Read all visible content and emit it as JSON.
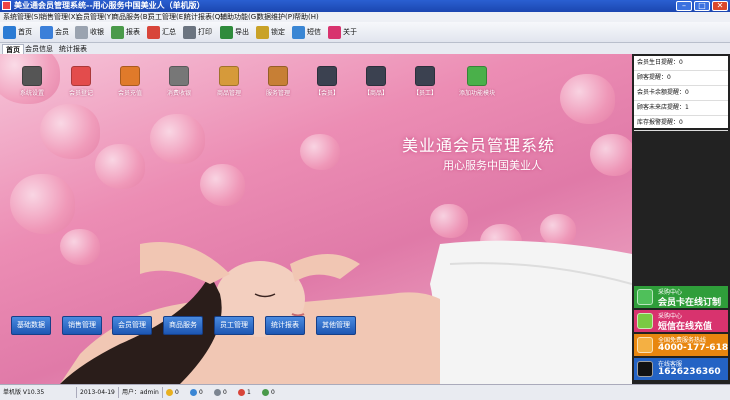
{
  "window": {
    "title": "美业通会员管理系统--用心服务中国美业人（单机版）",
    "minimize": "–",
    "maximize": "□",
    "close": "✕"
  },
  "menu": [
    "系统管理(S)",
    "销售管理(X)",
    "会员管理(Y)",
    "商品服务(B)",
    "员工管理(E)",
    "统计报表(Q)",
    "辅助功能(G)",
    "数据维护(P)",
    "帮助(H)"
  ],
  "toolbar": [
    {
      "label": "首页",
      "icon": "monitor-icon",
      "color": "#2b7bd4"
    },
    {
      "label": "会员",
      "icon": "member-card-icon",
      "color": "#3b7fd9"
    },
    {
      "label": "收银",
      "icon": "calculator-icon",
      "color": "#9aa3b0"
    },
    {
      "label": "报表",
      "icon": "spreadsheet-icon",
      "color": "#4a9a4a"
    },
    {
      "label": "汇总",
      "icon": "bar-chart-icon",
      "color": "#d8453a"
    },
    {
      "label": "打印",
      "icon": "printer-icon",
      "color": "#6b7480"
    },
    {
      "label": "导出",
      "icon": "excel-icon",
      "color": "#2f8b3c"
    },
    {
      "label": "锁定",
      "icon": "lock-icon",
      "color": "#c9a227"
    },
    {
      "label": "短信",
      "icon": "sms-icon",
      "color": "#3a86d4"
    },
    {
      "label": "关于",
      "icon": "about-icon",
      "color": "#d8336e"
    }
  ],
  "tabs": [
    "首页",
    "会员信息",
    "统计报表"
  ],
  "desktop_icons": [
    {
      "label": "系统设置",
      "icon": "settings-icon",
      "color": "#555"
    },
    {
      "label": "会员登记",
      "icon": "register-icon",
      "color": "#e34c4c"
    },
    {
      "label": "会员充值",
      "icon": "recharge-icon",
      "color": "#e07a2a"
    },
    {
      "label": "消费收银",
      "icon": "cashier-icon",
      "color": "#777"
    },
    {
      "label": "商品管理",
      "icon": "goods-icon",
      "color": "#d69a3a"
    },
    {
      "label": "服务管理",
      "icon": "service-icon",
      "color": "#c77f35"
    },
    {
      "label": "【会员】",
      "icon": "member-report-icon",
      "color": "#3b4150"
    },
    {
      "label": "【商品】",
      "icon": "goods-report-icon",
      "color": "#3b4150"
    },
    {
      "label": "【员工】",
      "icon": "staff-report-icon",
      "color": "#3b4150"
    },
    {
      "label": "添加功能模块",
      "icon": "add-module-icon",
      "color": "#4ab04a"
    }
  ],
  "banner": {
    "title": "美业通会员管理系统",
    "subtitle": "用心服务中国美业人"
  },
  "module_buttons": [
    "基础数据",
    "销售管理",
    "会员管理",
    "商品服务",
    "员工管理",
    "统计报表",
    "其他管理"
  ],
  "reminders": [
    "会员生日提醒：0",
    "顾客提醒：0",
    "会员卡余额提醒：0",
    "顾客未来店提醒：1",
    "库存报警提醒：0"
  ],
  "ads": [
    {
      "small": "采购中心",
      "big": "会员卡在线订制",
      "color": "#2f9e3a",
      "icon": "card-order-icon"
    },
    {
      "small": "采购中心",
      "big": "短信在线充值",
      "color": "#d8336e",
      "icon": "sms-recharge-icon"
    },
    {
      "small": "全国免费服务热线",
      "big": "4000-177-618",
      "color": "#e8860f",
      "icon": "hotline-icon"
    },
    {
      "small": "在线客服",
      "big": "1626236360",
      "color": "#2463c4",
      "icon": "qq-icon"
    }
  ],
  "status": {
    "version": "单机版 V10.35",
    "date": "2013-04-19",
    "user": "用户：admin",
    "counts": [
      "0",
      "0",
      "0",
      "1",
      "0"
    ]
  }
}
